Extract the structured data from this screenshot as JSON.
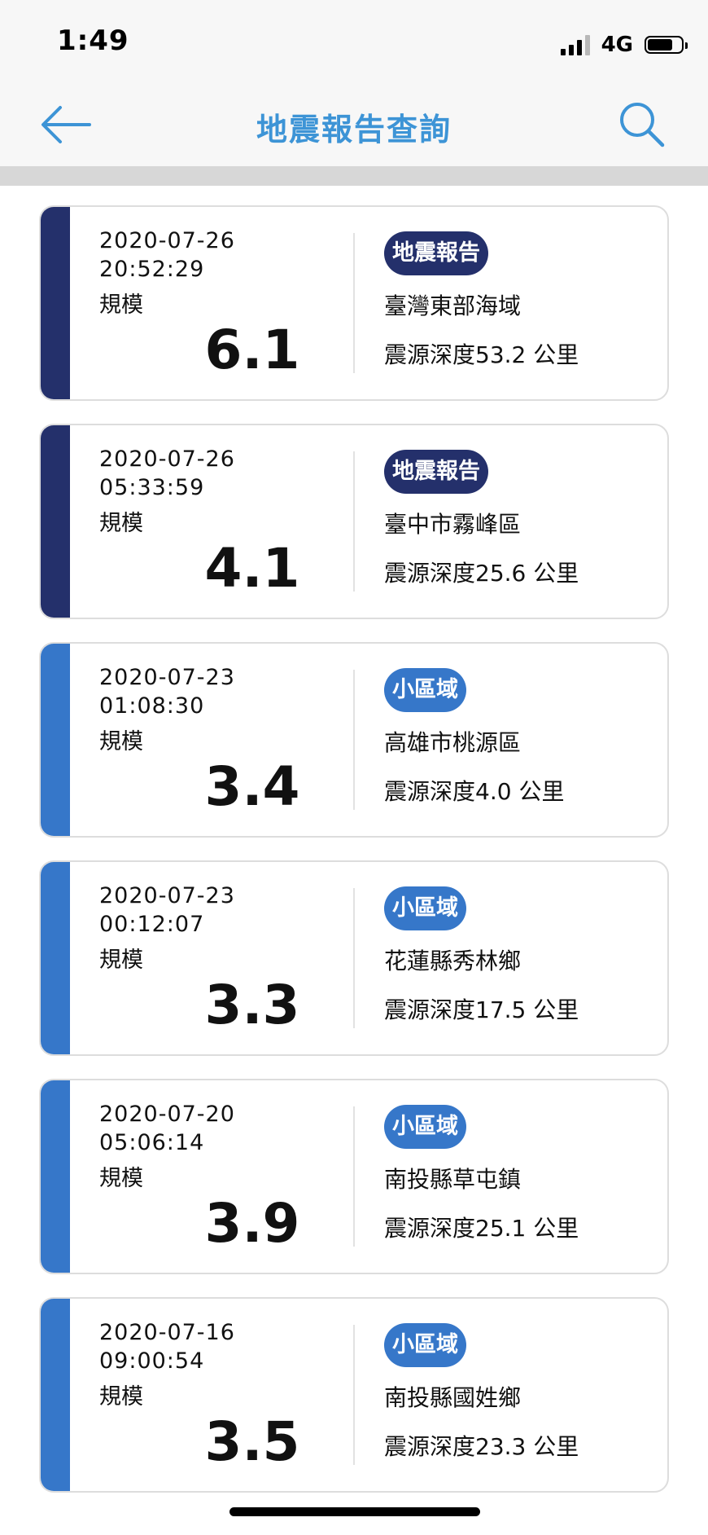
{
  "status_bar": {
    "time": "1:49",
    "network": "4G",
    "signal_icon": "cellular-signal-icon",
    "battery_icon": "battery-icon"
  },
  "nav": {
    "title": "地震報告查詢",
    "back_icon": "back-arrow-icon",
    "search_icon": "search-icon"
  },
  "colors": {
    "title": "#3d94d6",
    "report_accent": "#24306b",
    "local_accent": "#3677c9",
    "divider": "#d7d7d7"
  },
  "reports": [
    {
      "date": "2020-07-26",
      "time": "20:52:29",
      "magnitude_label": "規模",
      "magnitude": "6.1",
      "badge": "地震報告",
      "kind": "report",
      "location": "臺灣東部海域",
      "depth_label": "震源深度",
      "depth": "53.2",
      "depth_unit": "公里"
    },
    {
      "date": "2020-07-26",
      "time": "05:33:59",
      "magnitude_label": "規模",
      "magnitude": "4.1",
      "badge": "地震報告",
      "kind": "report",
      "location": "臺中市霧峰區",
      "depth_label": "震源深度",
      "depth": "25.6",
      "depth_unit": "公里"
    },
    {
      "date": "2020-07-23",
      "time": "01:08:30",
      "magnitude_label": "規模",
      "magnitude": "3.4",
      "badge": "小區域",
      "kind": "local",
      "location": "高雄市桃源區",
      "depth_label": "震源深度",
      "depth": "4.0",
      "depth_unit": "公里"
    },
    {
      "date": "2020-07-23",
      "time": "00:12:07",
      "magnitude_label": "規模",
      "magnitude": "3.3",
      "badge": "小區域",
      "kind": "local",
      "location": "花蓮縣秀林鄉",
      "depth_label": "震源深度",
      "depth": "17.5",
      "depth_unit": "公里"
    },
    {
      "date": "2020-07-20",
      "time": "05:06:14",
      "magnitude_label": "規模",
      "magnitude": "3.9",
      "badge": "小區域",
      "kind": "local",
      "location": "南投縣草屯鎮",
      "depth_label": "震源深度",
      "depth": "25.1",
      "depth_unit": "公里"
    },
    {
      "date": "2020-07-16",
      "time": "09:00:54",
      "magnitude_label": "規模",
      "magnitude": "3.5",
      "badge": "小區域",
      "kind": "local",
      "location": "南投縣國姓鄉",
      "depth_label": "震源深度",
      "depth": "23.3",
      "depth_unit": "公里"
    }
  ]
}
